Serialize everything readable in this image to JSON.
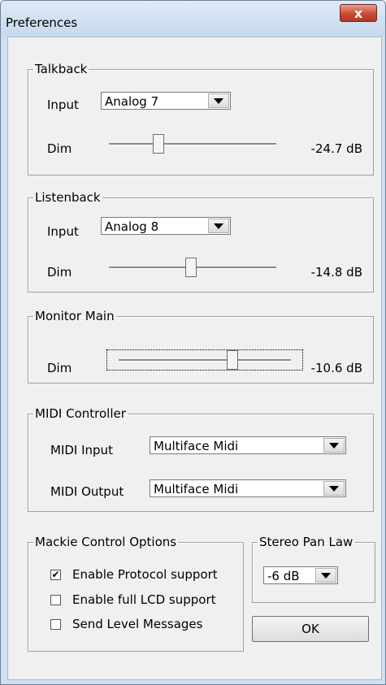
{
  "window": {
    "title": "Preferences",
    "close_glyph": "x"
  },
  "talkback": {
    "legend": "Talkback",
    "input_label": "Input",
    "input_value": "Analog 7",
    "dim_label": "Dim",
    "dim_value": "-24.7 dB",
    "dim_position": 0.28
  },
  "listenback": {
    "legend": "Listenback",
    "input_label": "Input",
    "input_value": "Analog 8",
    "dim_label": "Dim",
    "dim_value": "-14.8 dB",
    "dim_position": 0.49
  },
  "monitor_main": {
    "legend": "Monitor Main",
    "dim_label": "Dim",
    "dim_value": "-10.6 dB",
    "dim_position": 0.65
  },
  "midi": {
    "legend": "MIDI Controller",
    "input_label": "MIDI Input",
    "input_value": "Multiface Midi",
    "output_label": "MIDI Output",
    "output_value": "Multiface Midi"
  },
  "mackie": {
    "legend": "Mackie Control Options",
    "options": [
      {
        "label": "Enable Protocol support",
        "checked": true
      },
      {
        "label": "Enable full LCD support",
        "checked": false
      },
      {
        "label": "Send Level Messages",
        "checked": false
      }
    ]
  },
  "pan_law": {
    "legend": "Stereo Pan Law",
    "value": "-6 dB"
  },
  "ok_label": "OK",
  "icons": {
    "close": "close-icon",
    "dropdown": "chevron-down-icon",
    "check": "check-icon"
  }
}
